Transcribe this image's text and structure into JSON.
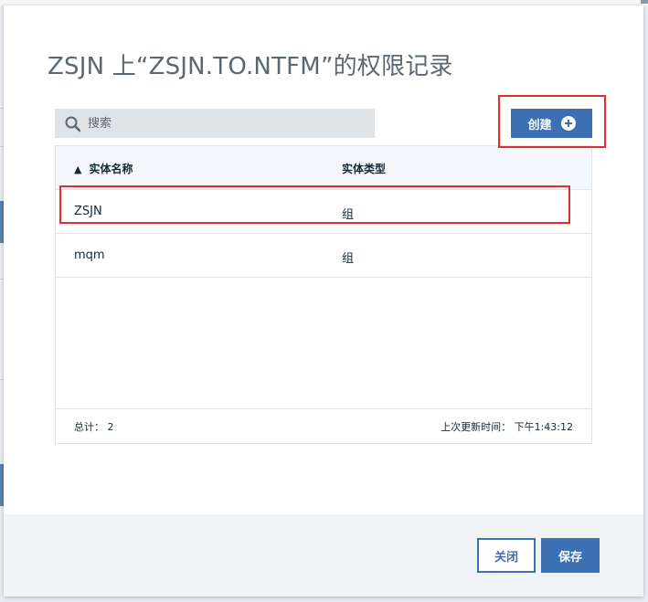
{
  "modal": {
    "title": "ZSJN 上“ZSJN.TO.NTFM”的权限记录"
  },
  "search": {
    "placeholder": "搜索",
    "value": ""
  },
  "toolbar": {
    "create_label": "创建"
  },
  "table": {
    "columns": [
      {
        "label": "实体名称",
        "sort": "▲"
      },
      {
        "label": "实体类型"
      }
    ],
    "rows": [
      {
        "name": "ZSJN",
        "type": "组"
      },
      {
        "name": "mqm",
        "type": "组"
      }
    ],
    "footer": {
      "total": "总计： 2",
      "last_updated": "上次更新时间： 下午1:43:12"
    }
  },
  "footer": {
    "close_label": "关闭",
    "save_label": "保存"
  },
  "colors": {
    "accent": "#3d70b2",
    "annotation": "#e52c2c",
    "search_bg": "#dfe3e6",
    "footer_bg": "#f0f3f6"
  }
}
